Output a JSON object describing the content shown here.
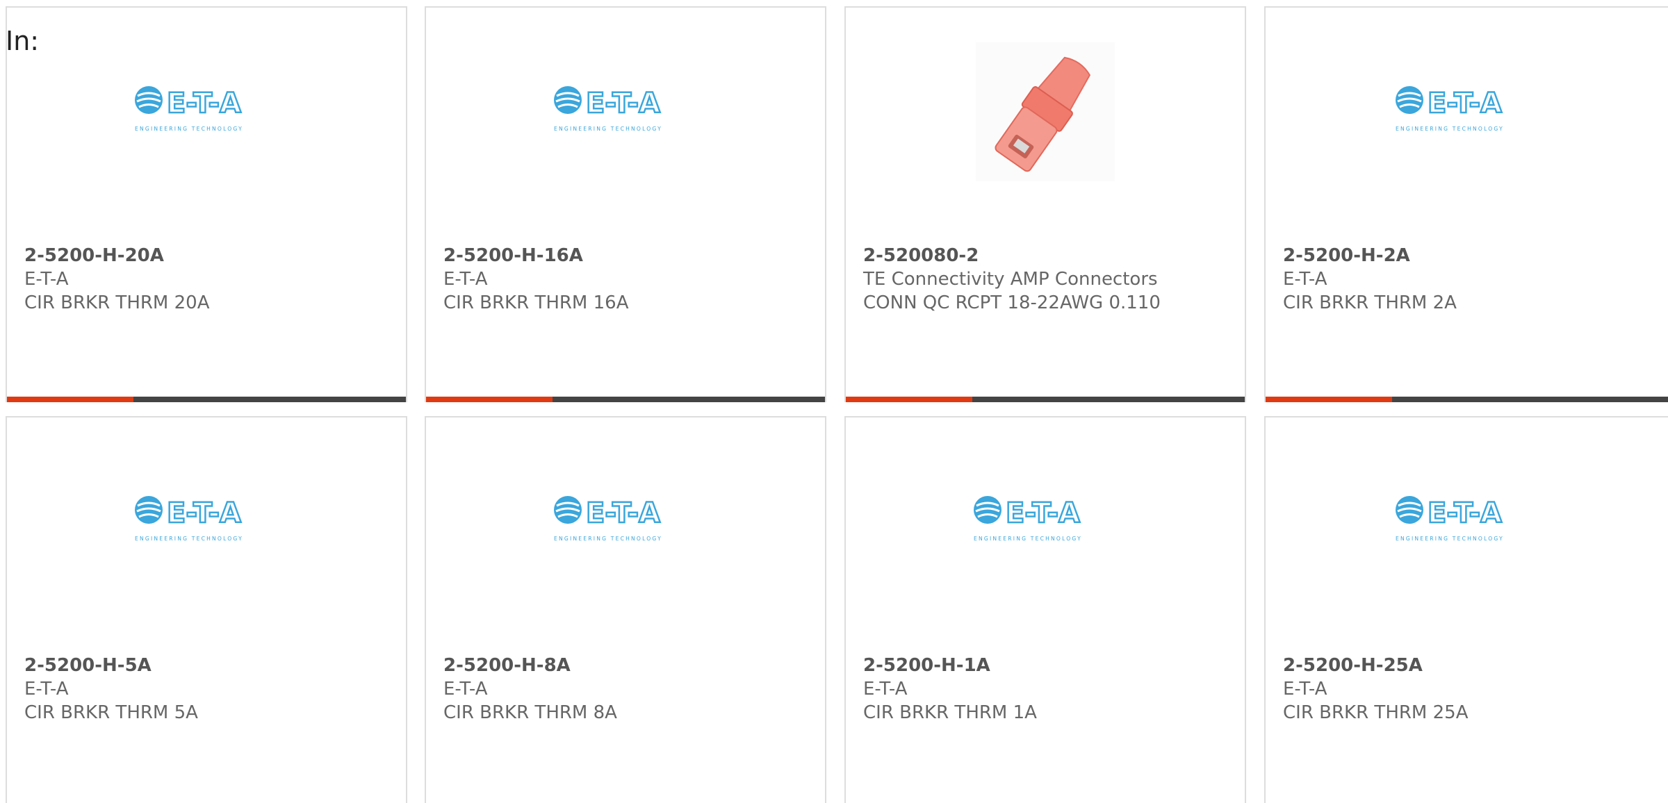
{
  "filter_label": "In:",
  "colors": {
    "accent": "#e03a12",
    "bar": "#444444",
    "logo_blue": "#3aa6dc"
  },
  "products": [
    {
      "part_number": "2-5200-H-20A",
      "manufacturer": "E-T-A",
      "description": "CIR BRKR THRM 20A",
      "image": "eta-logo"
    },
    {
      "part_number": "2-5200-H-16A",
      "manufacturer": "E-T-A",
      "description": "CIR BRKR THRM 16A",
      "image": "eta-logo"
    },
    {
      "part_number": "2-520080-2",
      "manufacturer": "TE Connectivity AMP Connectors",
      "description": "CONN QC RCPT 18-22AWG 0.110",
      "image": "red-connector"
    },
    {
      "part_number": "2-5200-H-2A",
      "manufacturer": "E-T-A",
      "description": "CIR BRKR THRM 2A",
      "image": "eta-logo"
    },
    {
      "part_number": "2-5200-H-5A",
      "manufacturer": "E-T-A",
      "description": "CIR BRKR THRM 5A",
      "image": "eta-logo"
    },
    {
      "part_number": "2-5200-H-8A",
      "manufacturer": "E-T-A",
      "description": "CIR BRKR THRM 8A",
      "image": "eta-logo"
    },
    {
      "part_number": "2-5200-H-1A",
      "manufacturer": "E-T-A",
      "description": "CIR BRKR THRM 1A",
      "image": "eta-logo"
    },
    {
      "part_number": "2-5200-H-25A",
      "manufacturer": "E-T-A",
      "description": "CIR BRKR THRM 25A",
      "image": "eta-logo"
    }
  ],
  "logo": {
    "brand_text": "E-T-A",
    "tagline": "ENGINEERING TECHNOLOGY"
  }
}
